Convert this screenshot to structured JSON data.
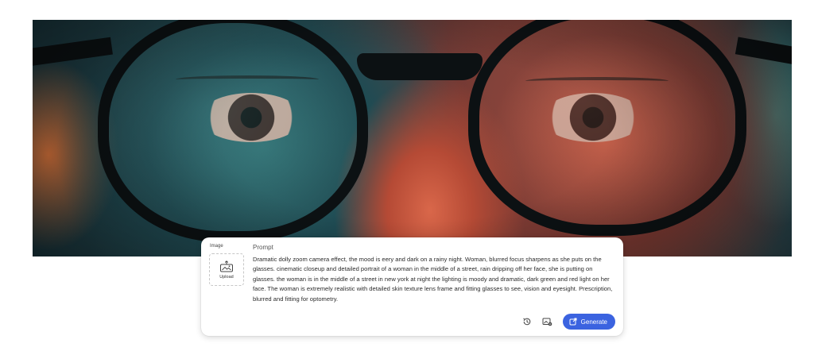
{
  "hero": {
    "description_icon": "hero-image"
  },
  "prompt_card": {
    "image_label": "Image",
    "upload_label": "Upload",
    "prompt_label": "Prompt",
    "prompt_text": "Dramatic dolly zoom camera effect, the mood is eery and dark on a rainy night. Woman, blurred focus sharpens as she puts on the glasses. cinematic closeup and detailed portrait of a woman in the middle of a street, rain dripping off her face, she is putting on glasses. the woman is in the middle of a street in new york at night the lighting is moody and dramatic, dark green and red light on her face. The woman is extremely realistic with detailed skin texture lens frame and fitting glasses to see, vision and eyesight. Prescription, blurred and fitting for optometry.",
    "actions": {
      "history_icon": "history-icon",
      "settings_icon": "image-settings-icon",
      "generate_label": "Generate",
      "generate_icon": "generate-icon"
    }
  },
  "colors": {
    "accent": "#3b63e0",
    "card_background": "#ffffff",
    "page_background": "#ffffff"
  }
}
